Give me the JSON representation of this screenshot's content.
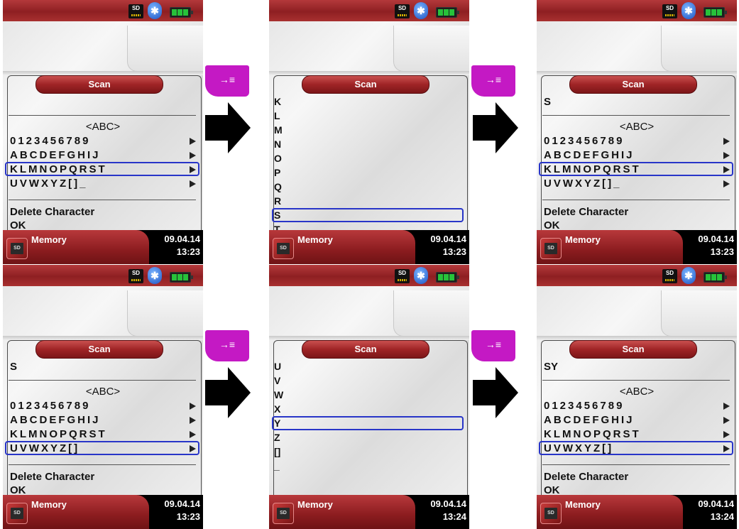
{
  "status": {
    "sd_label": "SD",
    "bluetooth_glyph": "✱"
  },
  "key_label": "→≡",
  "colors": {
    "statusbar": "#9e2a2c",
    "key": "#c419c4",
    "selection": "#2835c8"
  },
  "screens": [
    {
      "title": "Scan",
      "value": "",
      "abc_header": "<ABC>",
      "rows": [
        "0123456789",
        "ABCDEFGHIJ",
        "KLMNOPQRST",
        "UVWXYZ[]_"
      ],
      "selected_row": 2,
      "delete_label": "Delete Character",
      "ok_label": "OK",
      "footer": {
        "label": "Memory",
        "date": "09.04.14",
        "time": "13:23",
        "icon_text": "SD"
      }
    },
    {
      "title": "Scan",
      "letters": [
        "K",
        "L",
        "M",
        "N",
        "O",
        "P",
        "Q",
        "R",
        "S",
        "T"
      ],
      "selected_letter": 8,
      "footer": {
        "label": "Memory",
        "date": "09.04.14",
        "time": "13:23",
        "icon_text": "SD"
      }
    },
    {
      "title": "Scan",
      "value": "S",
      "abc_header": "<ABC>",
      "rows": [
        "0123456789",
        "ABCDEFGHIJ",
        "KLMNOPQRST",
        "UVWXYZ[]_"
      ],
      "selected_row": 2,
      "delete_label": "Delete Character",
      "ok_label": "OK",
      "footer": {
        "label": "Memory",
        "date": "09.04.14",
        "time": "13:23",
        "icon_text": "SD"
      }
    },
    {
      "title": "Scan",
      "value": "S",
      "abc_header": "<ABC>",
      "rows": [
        "0123456789",
        "ABCDEFGHIJ",
        "KLMNOPQRST",
        "UVWXYZ[]"
      ],
      "selected_row": 3,
      "delete_label": "Delete Character",
      "ok_label": "OK",
      "footer": {
        "label": "Memory",
        "date": "09.04.14",
        "time": "13:23",
        "icon_text": "SD"
      }
    },
    {
      "title": "Scan",
      "letters": [
        "U",
        "V",
        "W",
        "X",
        "Y",
        "Z",
        "[]",
        "_"
      ],
      "selected_letter": 4,
      "footer": {
        "label": "Memory",
        "date": "09.04.14",
        "time": "13:24",
        "icon_text": "SD"
      }
    },
    {
      "title": "Scan",
      "value": "SY",
      "abc_header": "<ABC>",
      "rows": [
        "0123456789",
        "ABCDEFGHIJ",
        "KLMNOPQRST",
        "UVWXYZ[]"
      ],
      "selected_row": 3,
      "delete_label": "Delete Character",
      "ok_label": "OK",
      "footer": {
        "label": "Memory",
        "date": "09.04.14",
        "time": "13:24",
        "icon_text": "SD"
      }
    }
  ]
}
